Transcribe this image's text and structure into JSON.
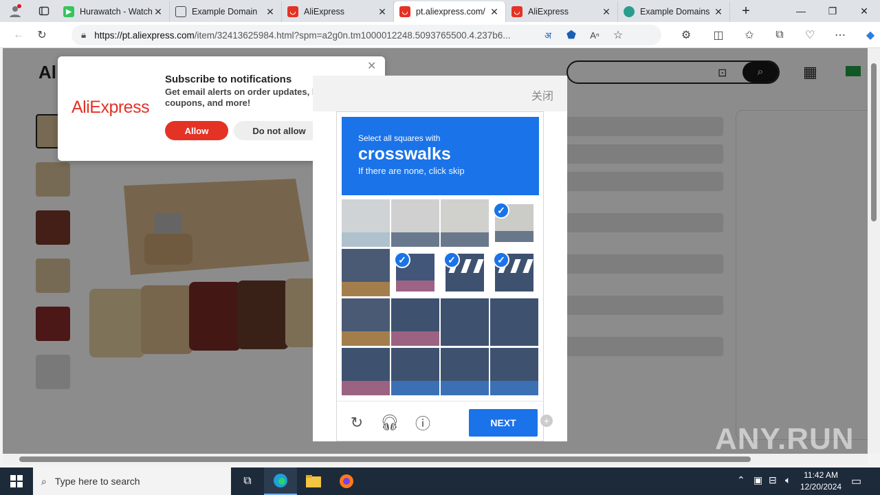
{
  "browser": {
    "tabs": [
      {
        "title": "Hurawatch - Watch",
        "icon_color": "#36c45c"
      },
      {
        "title": "Example Domain",
        "icon_color": "#ffffff"
      },
      {
        "title": "AliExpress",
        "icon_color": "#e43225"
      },
      {
        "title": "pt.aliexpress.com/",
        "icon_color": "#e43225",
        "active": true
      },
      {
        "title": "AliExpress",
        "icon_color": "#e43225"
      },
      {
        "title": "Example Domains",
        "icon_color": "#2a9d8f"
      }
    ],
    "url_host": "https://pt.aliexpress.com",
    "url_path": "/item/32413625984.html?spm=a2g0n.tm1000012248.5093765500.4.237b6..."
  },
  "notification": {
    "title": "Subscribe to notifications",
    "text": "Get email alerts on order updates, la discounts, coupons, and more!",
    "logo": "AliExpress",
    "allow_label": "Allow",
    "deny_label": "Do not allow"
  },
  "captcha": {
    "close_label": "关闭",
    "instruction_small": "Select all squares with",
    "target": "crosswalks",
    "hint": "If there are none, click skip",
    "next_label": "NEXT",
    "selected_cells": [
      3,
      5,
      6,
      7
    ]
  },
  "watermark": "ANY.RUN",
  "taskbar": {
    "search_placeholder": "Type here to search",
    "time": "11:42 AM",
    "date": "12/20/2024"
  },
  "colors": {
    "accent": "#1a73e8",
    "aliexpress_red": "#e43225"
  }
}
